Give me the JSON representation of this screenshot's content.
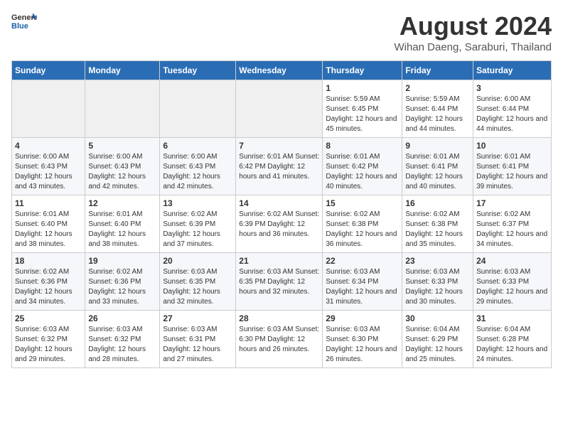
{
  "header": {
    "logo_general": "General",
    "logo_blue": "Blue",
    "title": "August 2024",
    "subtitle": "Wihan Daeng, Saraburi, Thailand"
  },
  "days_of_week": [
    "Sunday",
    "Monday",
    "Tuesday",
    "Wednesday",
    "Thursday",
    "Friday",
    "Saturday"
  ],
  "weeks": [
    [
      {
        "day": "",
        "content": ""
      },
      {
        "day": "",
        "content": ""
      },
      {
        "day": "",
        "content": ""
      },
      {
        "day": "",
        "content": ""
      },
      {
        "day": "1",
        "content": "Sunrise: 5:59 AM\nSunset: 6:45 PM\nDaylight: 12 hours\nand 45 minutes."
      },
      {
        "day": "2",
        "content": "Sunrise: 5:59 AM\nSunset: 6:44 PM\nDaylight: 12 hours\nand 44 minutes."
      },
      {
        "day": "3",
        "content": "Sunrise: 6:00 AM\nSunset: 6:44 PM\nDaylight: 12 hours\nand 44 minutes."
      }
    ],
    [
      {
        "day": "4",
        "content": "Sunrise: 6:00 AM\nSunset: 6:43 PM\nDaylight: 12 hours\nand 43 minutes."
      },
      {
        "day": "5",
        "content": "Sunrise: 6:00 AM\nSunset: 6:43 PM\nDaylight: 12 hours\nand 42 minutes."
      },
      {
        "day": "6",
        "content": "Sunrise: 6:00 AM\nSunset: 6:43 PM\nDaylight: 12 hours\nand 42 minutes."
      },
      {
        "day": "7",
        "content": "Sunrise: 6:01 AM\nSunset: 6:42 PM\nDaylight: 12 hours\nand 41 minutes."
      },
      {
        "day": "8",
        "content": "Sunrise: 6:01 AM\nSunset: 6:42 PM\nDaylight: 12 hours\nand 40 minutes."
      },
      {
        "day": "9",
        "content": "Sunrise: 6:01 AM\nSunset: 6:41 PM\nDaylight: 12 hours\nand 40 minutes."
      },
      {
        "day": "10",
        "content": "Sunrise: 6:01 AM\nSunset: 6:41 PM\nDaylight: 12 hours\nand 39 minutes."
      }
    ],
    [
      {
        "day": "11",
        "content": "Sunrise: 6:01 AM\nSunset: 6:40 PM\nDaylight: 12 hours\nand 38 minutes."
      },
      {
        "day": "12",
        "content": "Sunrise: 6:01 AM\nSunset: 6:40 PM\nDaylight: 12 hours\nand 38 minutes."
      },
      {
        "day": "13",
        "content": "Sunrise: 6:02 AM\nSunset: 6:39 PM\nDaylight: 12 hours\nand 37 minutes."
      },
      {
        "day": "14",
        "content": "Sunrise: 6:02 AM\nSunset: 6:39 PM\nDaylight: 12 hours\nand 36 minutes."
      },
      {
        "day": "15",
        "content": "Sunrise: 6:02 AM\nSunset: 6:38 PM\nDaylight: 12 hours\nand 36 minutes."
      },
      {
        "day": "16",
        "content": "Sunrise: 6:02 AM\nSunset: 6:38 PM\nDaylight: 12 hours\nand 35 minutes."
      },
      {
        "day": "17",
        "content": "Sunrise: 6:02 AM\nSunset: 6:37 PM\nDaylight: 12 hours\nand 34 minutes."
      }
    ],
    [
      {
        "day": "18",
        "content": "Sunrise: 6:02 AM\nSunset: 6:36 PM\nDaylight: 12 hours\nand 34 minutes."
      },
      {
        "day": "19",
        "content": "Sunrise: 6:02 AM\nSunset: 6:36 PM\nDaylight: 12 hours\nand 33 minutes."
      },
      {
        "day": "20",
        "content": "Sunrise: 6:03 AM\nSunset: 6:35 PM\nDaylight: 12 hours\nand 32 minutes."
      },
      {
        "day": "21",
        "content": "Sunrise: 6:03 AM\nSunset: 6:35 PM\nDaylight: 12 hours\nand 32 minutes."
      },
      {
        "day": "22",
        "content": "Sunrise: 6:03 AM\nSunset: 6:34 PM\nDaylight: 12 hours\nand 31 minutes."
      },
      {
        "day": "23",
        "content": "Sunrise: 6:03 AM\nSunset: 6:33 PM\nDaylight: 12 hours\nand 30 minutes."
      },
      {
        "day": "24",
        "content": "Sunrise: 6:03 AM\nSunset: 6:33 PM\nDaylight: 12 hours\nand 29 minutes."
      }
    ],
    [
      {
        "day": "25",
        "content": "Sunrise: 6:03 AM\nSunset: 6:32 PM\nDaylight: 12 hours\nand 29 minutes."
      },
      {
        "day": "26",
        "content": "Sunrise: 6:03 AM\nSunset: 6:32 PM\nDaylight: 12 hours\nand 28 minutes."
      },
      {
        "day": "27",
        "content": "Sunrise: 6:03 AM\nSunset: 6:31 PM\nDaylight: 12 hours\nand 27 minutes."
      },
      {
        "day": "28",
        "content": "Sunrise: 6:03 AM\nSunset: 6:30 PM\nDaylight: 12 hours\nand 26 minutes."
      },
      {
        "day": "29",
        "content": "Sunrise: 6:03 AM\nSunset: 6:30 PM\nDaylight: 12 hours\nand 26 minutes."
      },
      {
        "day": "30",
        "content": "Sunrise: 6:04 AM\nSunset: 6:29 PM\nDaylight: 12 hours\nand 25 minutes."
      },
      {
        "day": "31",
        "content": "Sunrise: 6:04 AM\nSunset: 6:28 PM\nDaylight: 12 hours\nand 24 minutes."
      }
    ]
  ]
}
